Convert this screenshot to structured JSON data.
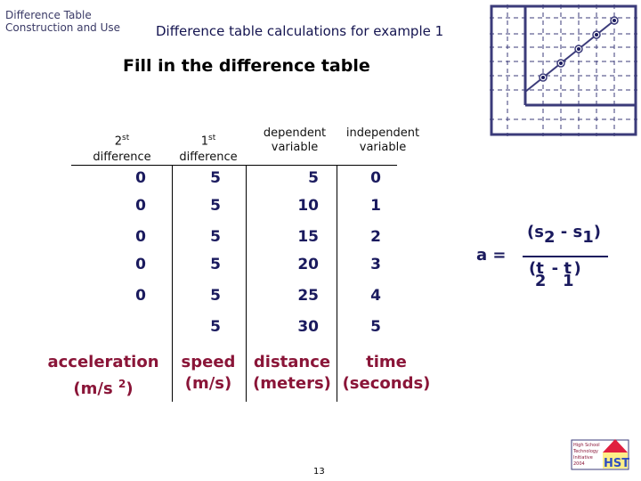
{
  "header": {
    "subtitle_line1": "Difference Table",
    "subtitle_line2": "Construction and Use",
    "slide_title": "Difference table calculations for example 1",
    "heading": "Fill in the difference table"
  },
  "table": {
    "columns": [
      {
        "label_num": "2",
        "label_sup": "st",
        "label_text": "difference"
      },
      {
        "label_num": "1",
        "label_sup": "st",
        "label_text": "difference"
      },
      {
        "label_line1": "dependent",
        "label_line2": "variable"
      },
      {
        "label_line1": "independent",
        "label_line2": "variable"
      }
    ],
    "second_difference": [
      "0",
      "0",
      "0",
      "0",
      "0"
    ],
    "first_difference": [
      "5",
      "5",
      "5",
      "5",
      "5",
      "5"
    ],
    "dependent": [
      "5",
      "10",
      "15",
      "20",
      "25",
      "30"
    ],
    "independent": [
      "0",
      "1",
      "2",
      "3",
      "4",
      "5"
    ],
    "units": [
      {
        "line1": "acceleration",
        "line2": "(m/s",
        "sup": "2",
        "close": ")"
      },
      {
        "line1": "speed",
        "line2": "(m/s)"
      },
      {
        "line1": "distance",
        "line2": "(meters)"
      },
      {
        "line1": "time",
        "line2": "(seconds)"
      }
    ]
  },
  "formula": {
    "lhs": "a =",
    "num_open": "(s",
    "num_sub1": "2",
    "num_mid": " - s",
    "num_sub2": "1",
    "num_close": ")",
    "den_open": "(t",
    "den_sub1": "2",
    "den_mid": " - t",
    "den_sub2": "1",
    "den_close": ")"
  },
  "graph": {
    "icon": "line-graph-icon",
    "points": [
      [
        0,
        0
      ],
      [
        1,
        1
      ],
      [
        2,
        2
      ],
      [
        3,
        3
      ],
      [
        4,
        4
      ],
      [
        5,
        5
      ]
    ]
  },
  "logo": {
    "icon": "hsti-logo-icon",
    "text_lines": [
      "High School",
      "Technology",
      "Initiative",
      "2004"
    ],
    "letters": "HSTi"
  },
  "footer": {
    "page_number": "13"
  },
  "colors": {
    "navy": "#1a1a5e",
    "maroon": "#8a1538",
    "grid": "#3b3b7a"
  }
}
